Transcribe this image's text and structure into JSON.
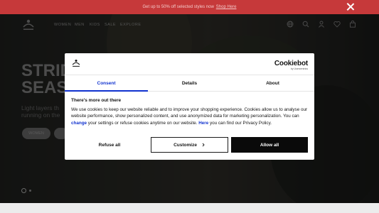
{
  "promo": {
    "text": "Get up to 50% off selected styles now",
    "link_label": "Shop Here"
  },
  "nav": {
    "items": [
      "WOMEN",
      "MEN",
      "KIDS",
      "SALE",
      "EXPLORE"
    ]
  },
  "hero": {
    "title_line1": "STRID",
    "title_line2": "SEAS",
    "subtitle_line1": "Light layers th",
    "subtitle_line2": "running on the",
    "button_women": "WOMEN"
  },
  "dialog": {
    "brand_name": "Cookiebot",
    "brand_by": "by Usercentrics",
    "tabs": [
      {
        "label": "Consent"
      },
      {
        "label": "Details"
      },
      {
        "label": "About"
      }
    ],
    "heading": "There's more out there",
    "body_part1": "We use cookies to keep our website reliable and to improve your shopping experience. Cookies allow us to analyse our website performance, show personalized content, and use anonymized data for marketing personalization. You can ",
    "body_link_change": "change",
    "body_part2": " your settings or refuse cookies anytime on our website. ",
    "body_link_here": "Here",
    "body_part3": " you can find our Privacy Policy.",
    "deny_label": "Refuse all",
    "customize_label": "Customize",
    "allow_label": "Allow all"
  },
  "colors": {
    "promo_bg": "#c6393a",
    "accent_blue": "#1032cf",
    "allow_bg": "#0a0a0a"
  },
  "icons": [
    "globe-icon",
    "search-icon",
    "account-icon",
    "heart-icon",
    "bag-icon",
    "close-icon",
    "chevron-right-icon"
  ]
}
